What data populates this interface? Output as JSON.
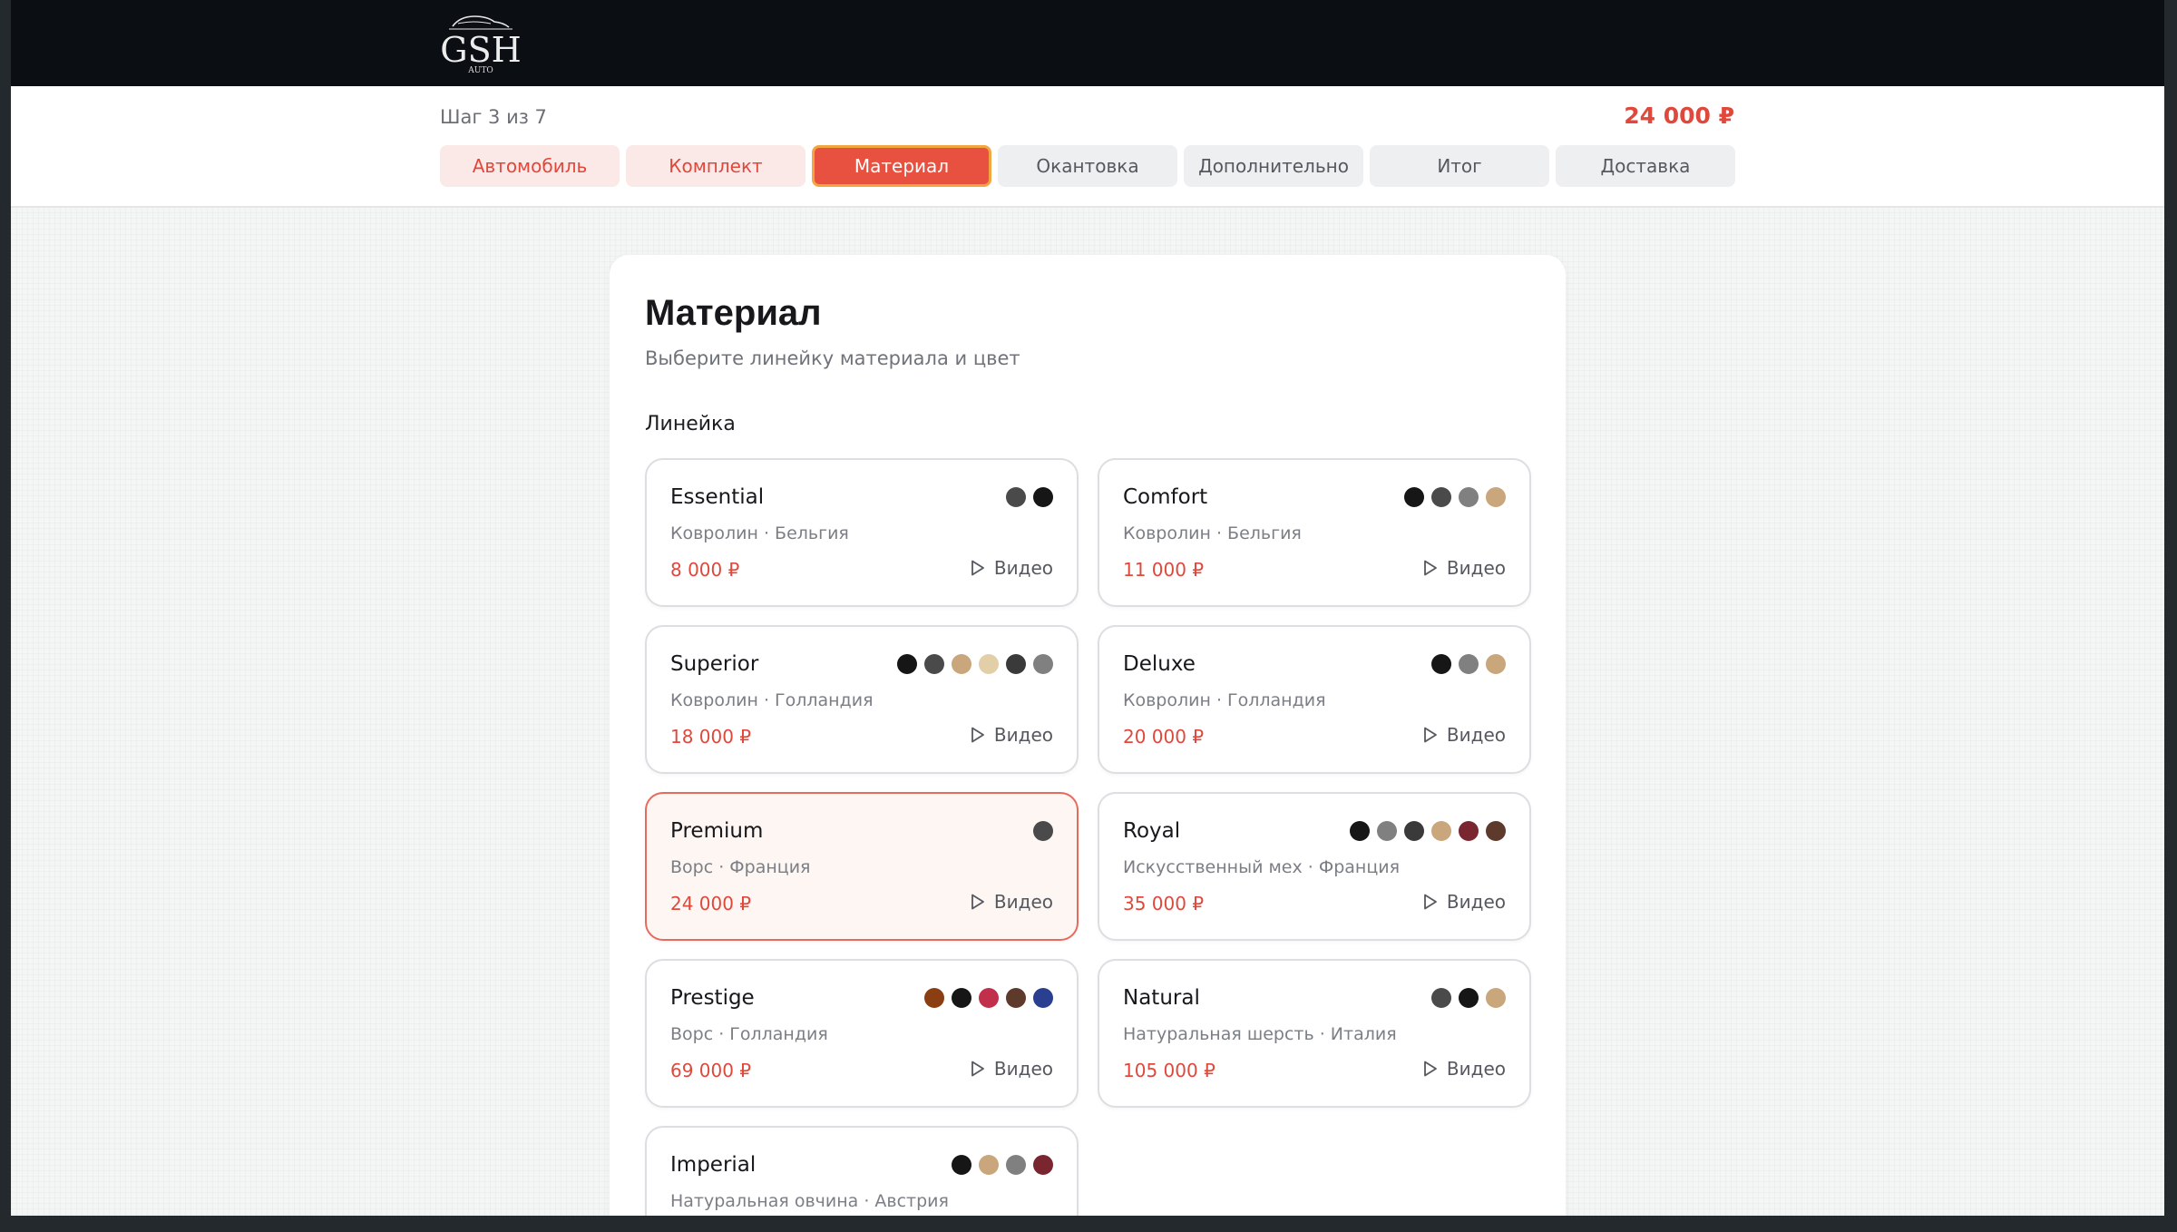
{
  "header": {
    "logo_text": "GSH",
    "logo_sub": "AUTO"
  },
  "progress": {
    "step_text": "Шаг 3 из 7",
    "total": "24 000 ₽"
  },
  "tabs": [
    {
      "label": "Автомобиль",
      "state": "done"
    },
    {
      "label": "Комплект",
      "state": "done"
    },
    {
      "label": "Материал",
      "state": "active"
    },
    {
      "label": "Окантовка",
      "state": "todo"
    },
    {
      "label": "Дополнительно",
      "state": "todo"
    },
    {
      "label": "Итог",
      "state": "todo"
    },
    {
      "label": "Доставка",
      "state": "todo"
    }
  ],
  "main": {
    "title": "Материал",
    "subtitle": "Выберите линейку материала и цвет",
    "section_label": "Линейка",
    "video_label": "Видео",
    "cards": [
      {
        "name": "Essential",
        "desc": "Ковролин · Бельгия",
        "price": "8 000 ₽",
        "selected": false,
        "colors": [
          "#4a4a4a",
          "#161616"
        ]
      },
      {
        "name": "Comfort",
        "desc": "Ковролин · Бельгия",
        "price": "11 000 ₽",
        "selected": false,
        "colors": [
          "#161616",
          "#4a4a4a",
          "#808080",
          "#c9a67c"
        ]
      },
      {
        "name": "Superior",
        "desc": "Ковролин · Голландия",
        "price": "18 000 ₽",
        "selected": false,
        "colors": [
          "#161616",
          "#4a4a4a",
          "#c9a67c",
          "#e2cfa7",
          "#3a3a3a",
          "#808080"
        ]
      },
      {
        "name": "Deluxe",
        "desc": "Ковролин · Голландия",
        "price": "20 000 ₽",
        "selected": false,
        "colors": [
          "#161616",
          "#808080",
          "#c9a67c"
        ]
      },
      {
        "name": "Premium",
        "desc": "Ворс · Франция",
        "price": "24 000 ₽",
        "selected": true,
        "colors": [
          "#4a4a4a"
        ]
      },
      {
        "name": "Royal",
        "desc": "Искусственный мех · Франция",
        "price": "35 000 ₽",
        "selected": false,
        "colors": [
          "#161616",
          "#808080",
          "#3a3a3a",
          "#c9a67c",
          "#7a2630",
          "#5e3a2c"
        ]
      },
      {
        "name": "Prestige",
        "desc": "Ворс · Голландия",
        "price": "69 000 ₽",
        "selected": false,
        "colors": [
          "#8b3e12",
          "#161616",
          "#c0304a",
          "#5e3a2c",
          "#2a3f8f"
        ]
      },
      {
        "name": "Natural",
        "desc": "Натуральная шерсть · Италия",
        "price": "105 000 ₽",
        "selected": false,
        "colors": [
          "#4a4a4a",
          "#161616",
          "#c9a67c"
        ]
      },
      {
        "name": "Imperial",
        "desc": "Натуральная овчина · Австрия",
        "price": "",
        "selected": false,
        "colors": [
          "#161616",
          "#c9a67c",
          "#808080",
          "#7a2630"
        ]
      }
    ]
  },
  "colors": {
    "accent": "#e0483c",
    "active_tab_bg": "#e8503f",
    "active_tab_border": "#f2a540",
    "topbar": "#0b0e12"
  },
  "icons": {
    "video": "play-icon"
  }
}
